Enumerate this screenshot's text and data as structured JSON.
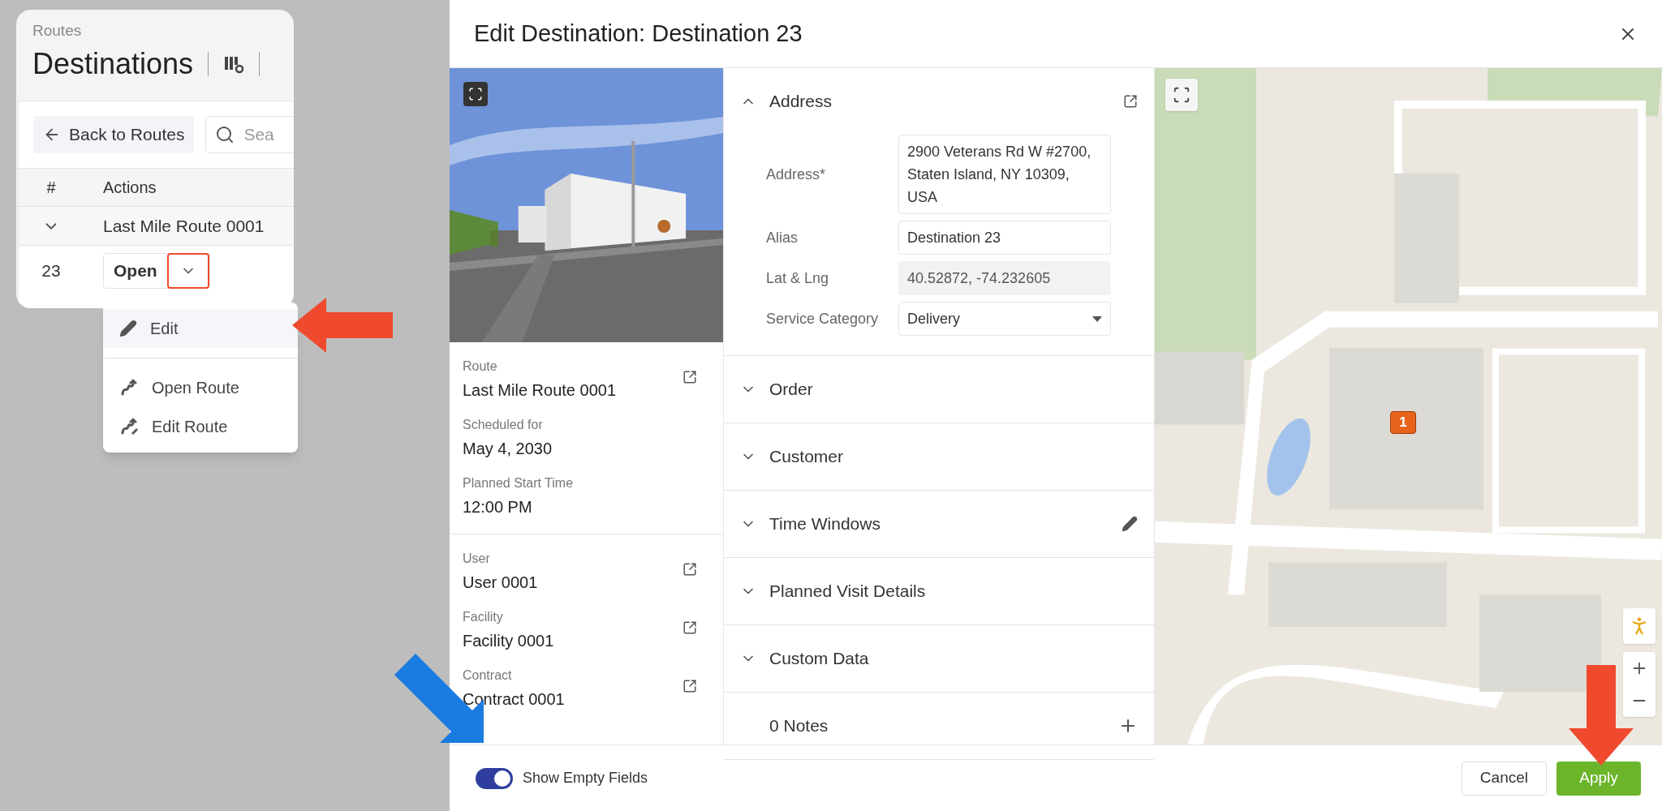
{
  "page": {
    "breadcrumb": "Routes",
    "title": "Destinations",
    "back_button": "Back to Routes",
    "search": {
      "placeholder": "Sea"
    },
    "table": {
      "columns": [
        "#",
        "Actions"
      ],
      "group": {
        "label": "Last Mile Route 0001",
        "expanded": true
      },
      "rows": [
        {
          "number": "23",
          "action": "Open",
          "menu_open": true
        }
      ]
    },
    "action_menu": [
      {
        "label": "Edit",
        "kind": "edit",
        "selected": true
      },
      {
        "label": "Open Route",
        "kind": "route",
        "selected": false
      },
      {
        "label": "Edit Route",
        "kind": "route-edit",
        "selected": false
      }
    ]
  },
  "dialog": {
    "title": "Edit Destination: Destination 23",
    "summary_groups": [
      [
        {
          "label": "Route",
          "value": "Last Mile Route 0001",
          "link": true
        },
        {
          "label": "Scheduled for",
          "value": "May 4, 2030",
          "link": false
        },
        {
          "label": "Planned Start Time",
          "value": "12:00 PM",
          "link": false
        }
      ],
      [
        {
          "label": "User",
          "value": "User 0001",
          "link": true
        },
        {
          "label": "Facility",
          "value": "Facility 0001",
          "link": true
        },
        {
          "label": "Contract",
          "value": "Contract 0001",
          "link": true
        }
      ]
    ],
    "sections": [
      {
        "title": "Address",
        "kind": "collapsible",
        "expanded": true,
        "has_link": true
      },
      {
        "title": "Order",
        "kind": "collapsible",
        "expanded": false
      },
      {
        "title": "Customer",
        "kind": "collapsible",
        "expanded": false
      },
      {
        "title": "Time Windows",
        "kind": "collapsible",
        "expanded": false,
        "editable": true
      },
      {
        "title": "Planned Visit Details",
        "kind": "collapsible",
        "expanded": false
      },
      {
        "title": "Custom Data",
        "kind": "collapsible",
        "expanded": false
      },
      {
        "title": "0 Notes",
        "kind": "plain",
        "can_add": true
      }
    ],
    "address_fields": [
      {
        "label": "Address*",
        "value": "2900 Veterans Rd W #2700, Staten Island, NY 10309, USA",
        "kind": "text"
      },
      {
        "label": "Alias",
        "value": "Destination 23",
        "kind": "text"
      },
      {
        "label": "Lat & Lng",
        "value": "40.52872, -74.232605",
        "kind": "readonly"
      },
      {
        "label": "Service Category",
        "value": "Delivery",
        "kind": "select"
      }
    ],
    "map": {
      "marker": "1"
    },
    "show_empty_fields": {
      "label": "Show Empty Fields",
      "on": true
    },
    "buttons": [
      {
        "label": "Cancel",
        "kind": "secondary"
      },
      {
        "label": "Apply",
        "kind": "primary"
      }
    ]
  }
}
